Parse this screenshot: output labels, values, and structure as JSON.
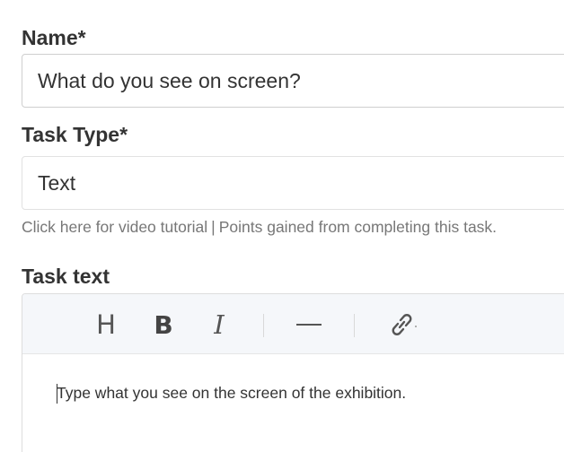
{
  "form": {
    "name_label": "Name*",
    "name_value": "What do you see on screen?",
    "task_type_label": "Task Type*",
    "task_type_value": "Text",
    "help_link": "Click here for video tutorial",
    "help_separator": "|",
    "help_text": "Points gained from completing this task.",
    "task_text_label": "Task text"
  },
  "editor": {
    "toolbar": {
      "heading": "H",
      "bold": "B",
      "italic": "I"
    },
    "content": "Type what you see on the screen of the exhibition."
  }
}
